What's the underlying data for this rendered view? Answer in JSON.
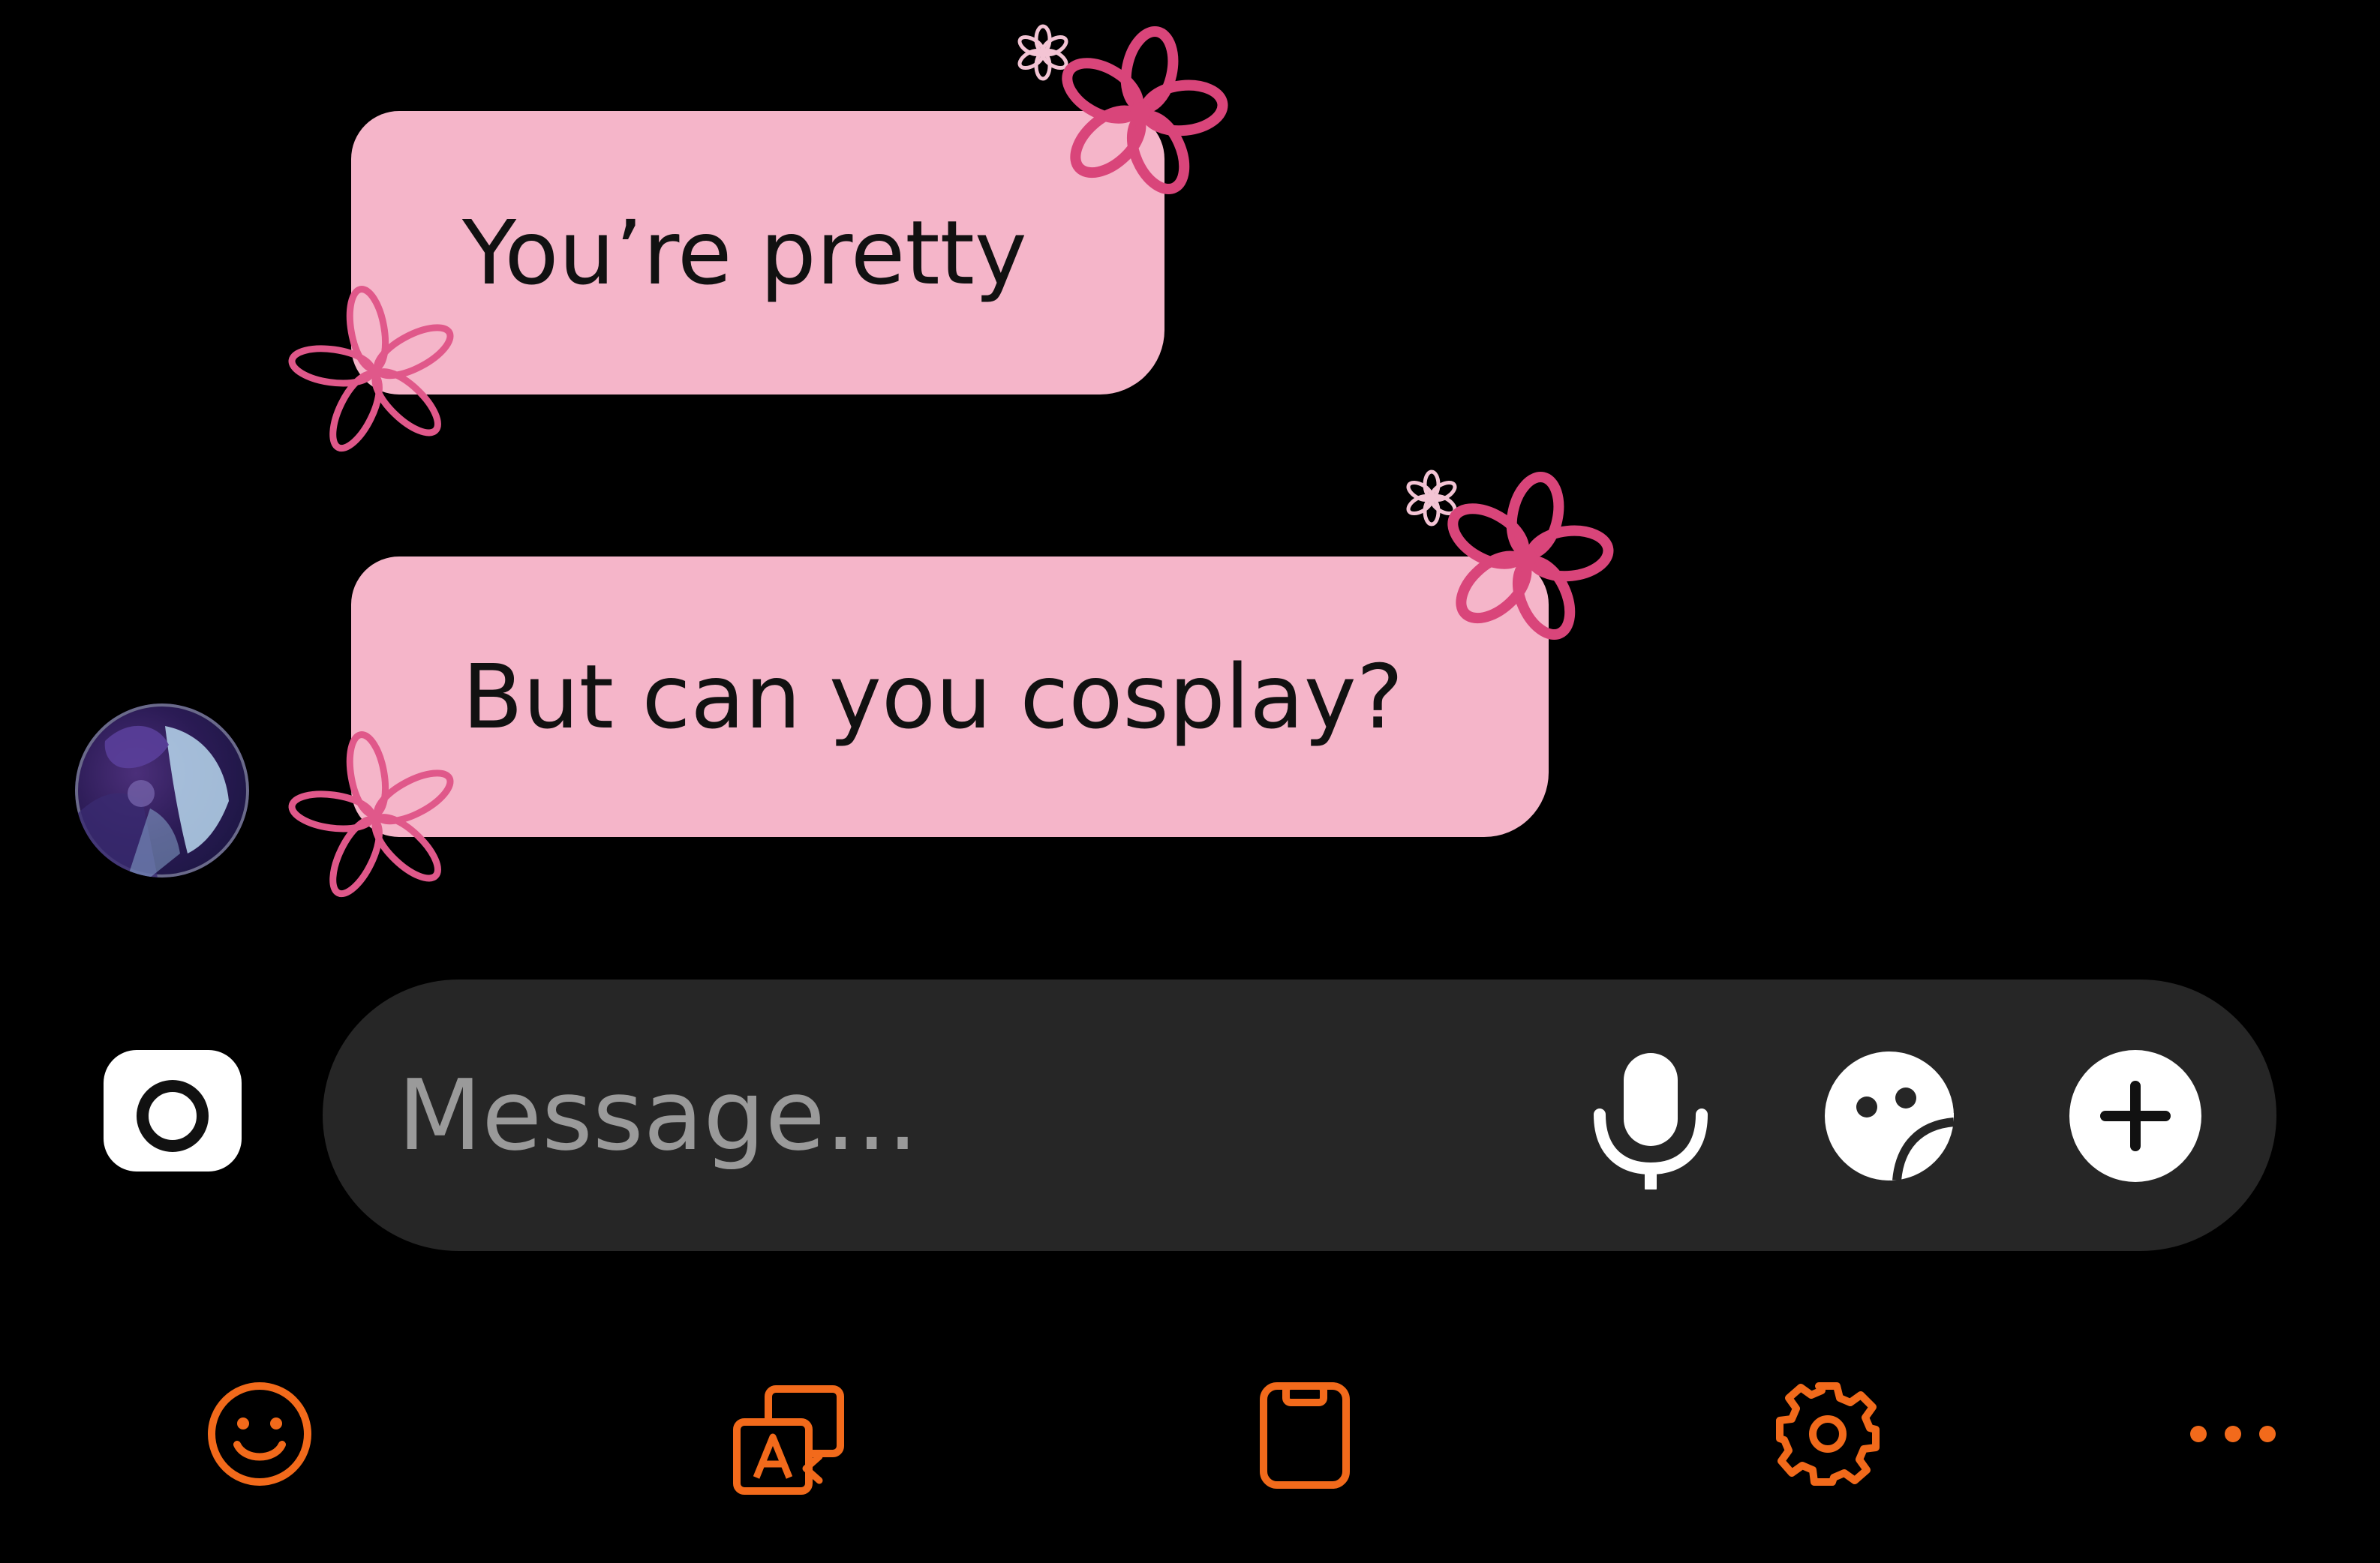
{
  "messages": [
    {
      "text": "You’re pretty"
    },
    {
      "text": "But can you cosplay?"
    }
  ],
  "composer": {
    "placeholder": "Message..."
  },
  "icons": {
    "camera": "camera-icon",
    "microphone": "microphone-icon",
    "sticker": "sticker-icon",
    "add": "plus-icon",
    "emoji": "emoji-icon",
    "translate": "translate-icon",
    "clipboard": "clipboard-icon",
    "settings": "gear-icon",
    "more": "more-icon"
  },
  "colors": {
    "background": "#000000",
    "bubble": "#f5b5c9",
    "flower": "#d9457a",
    "composer": "#262626",
    "keyboard_accent": "#f26a1b"
  }
}
